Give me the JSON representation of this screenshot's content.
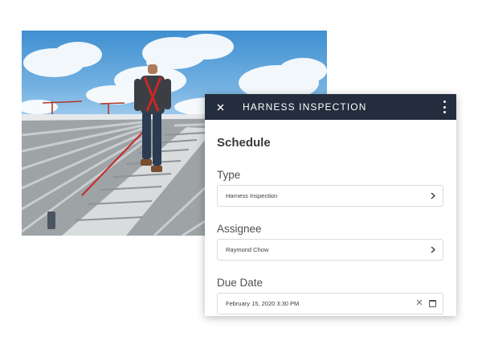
{
  "appbar": {
    "title": "HARNESS INSPECTION",
    "close_icon": "close-icon",
    "menu_icon": "more-vertical-icon"
  },
  "form": {
    "section_title": "Schedule",
    "type_label": "Type",
    "type_value": "Harness Inspection",
    "assignee_label": "Assignee",
    "assignee_value": "Raymond Chow",
    "due_date_label": "Due Date",
    "due_date_value": "February 15, 2020 3:30 PM"
  },
  "colors": {
    "appbar_bg": "#242d3d",
    "field_border": "#dadada"
  }
}
